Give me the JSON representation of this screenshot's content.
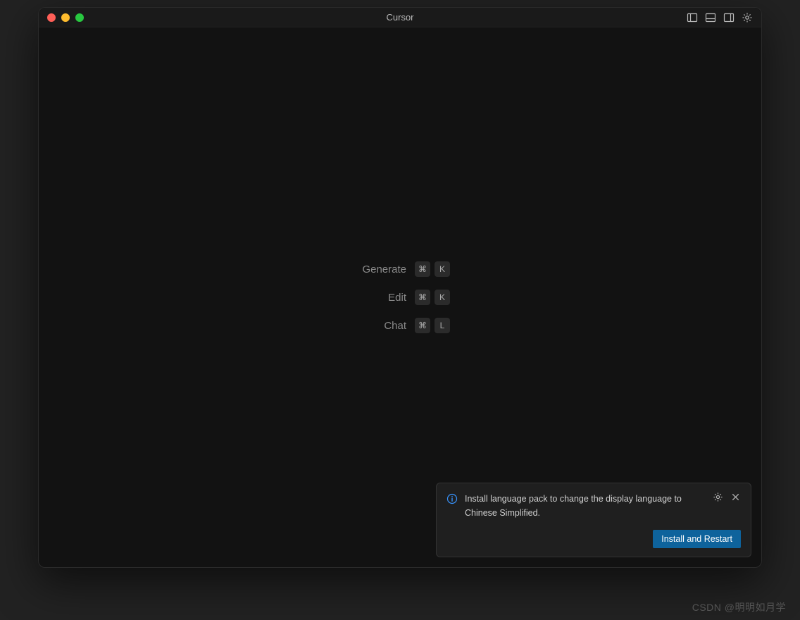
{
  "window": {
    "title": "Cursor"
  },
  "shortcuts": [
    {
      "label": "Generate",
      "keys": [
        "⌘",
        "K"
      ]
    },
    {
      "label": "Edit",
      "keys": [
        "⌘",
        "K"
      ]
    },
    {
      "label": "Chat",
      "keys": [
        "⌘",
        "L"
      ]
    }
  ],
  "notification": {
    "message": "Install language pack to change the display language to Chinese Simplified.",
    "action_label": "Install and Restart"
  },
  "watermark": "CSDN @明明如月学"
}
